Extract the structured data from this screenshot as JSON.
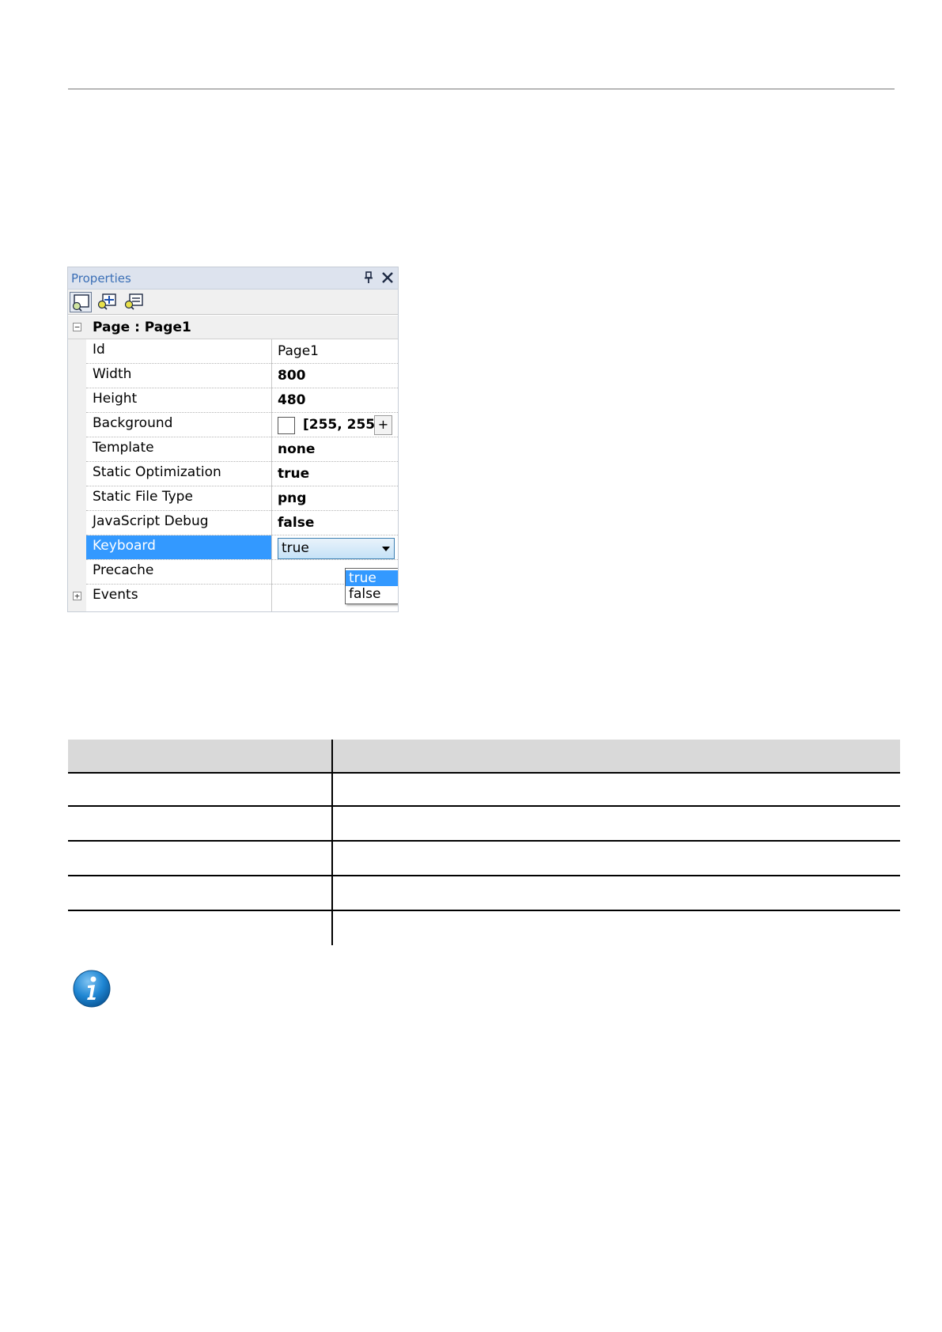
{
  "panel": {
    "title": "Properties",
    "group": {
      "title": "Page : Page1",
      "expander": "−"
    },
    "rows": [
      {
        "name": "Id",
        "value": "Page1"
      },
      {
        "name": "Width",
        "value": "800"
      },
      {
        "name": "Height",
        "value": "480"
      },
      {
        "name": "Background",
        "value": "[255, 255"
      },
      {
        "name": "Template",
        "value": "none"
      },
      {
        "name": "Static Optimization",
        "value": "true"
      },
      {
        "name": "Static File Type",
        "value": "png"
      },
      {
        "name": "JavaScript Debug",
        "value": "false"
      },
      {
        "name": "Keyboard",
        "value": "true"
      },
      {
        "name": "Precache",
        "value": ""
      }
    ],
    "events": {
      "label": "Events",
      "expander": "+"
    },
    "background_expand": "+",
    "dropdown_options": [
      "true",
      "false"
    ],
    "selected_option": "true",
    "colors": {
      "header": "#dde3ee",
      "title_text": "#3b6fb6",
      "selection": "#3399ff"
    }
  },
  "icons": {
    "pin": "pin-icon",
    "close": "close-icon",
    "toolbar": [
      "properties-view-icon",
      "add-property-icon",
      "event-view-icon"
    ],
    "info": "info-icon"
  }
}
